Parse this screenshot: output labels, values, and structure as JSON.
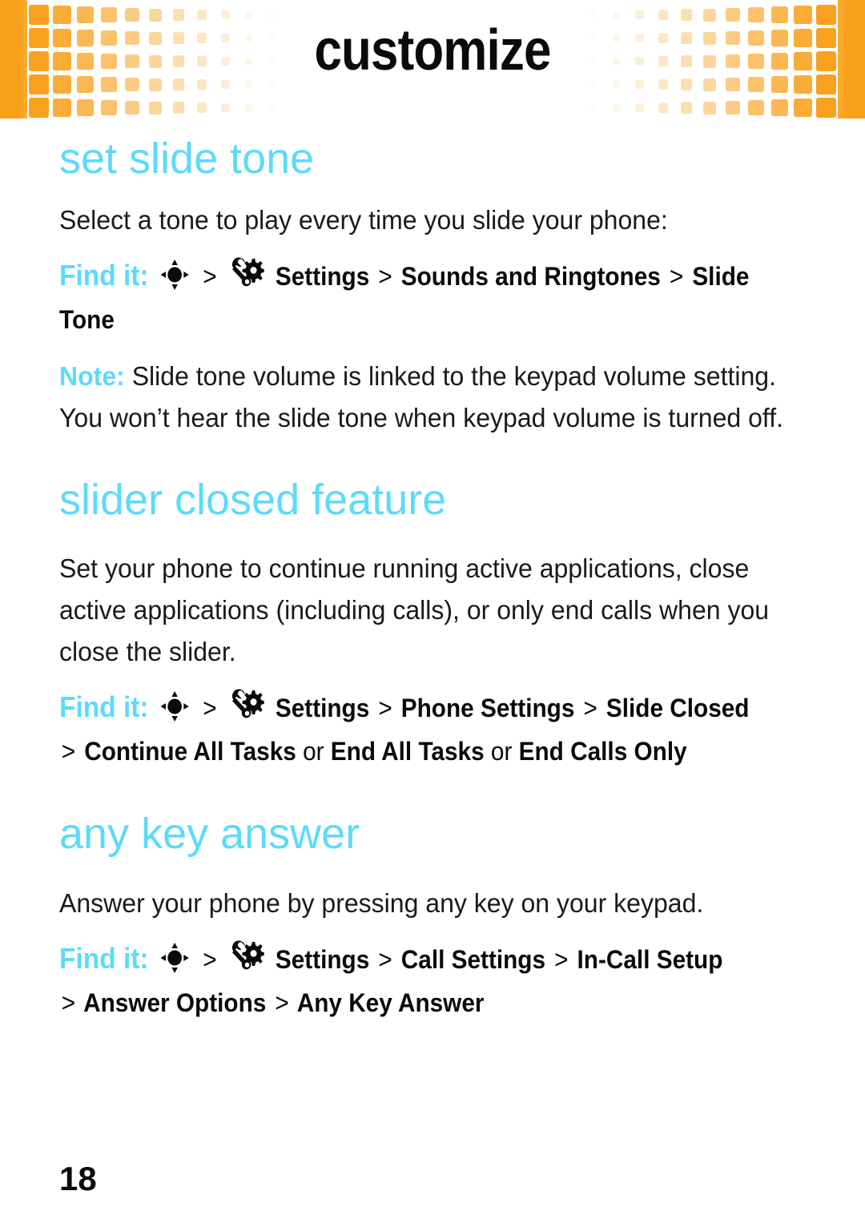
{
  "header": {
    "title": "customize",
    "accent_color": "#F9A01B"
  },
  "theme": {
    "heading_color": "#5BDBFA",
    "body_color": "#1a1a1a",
    "orange": "#F9A01B"
  },
  "icons": {
    "nav_key": "center-select-navigation-key-icon",
    "settings": "wrench-gear-settings-icon"
  },
  "sections": [
    {
      "heading": "set slide tone",
      "body": "Select a tone to play every time you slide your phone:",
      "findit": {
        "label": "Find it:",
        "crumbs": [
          "Settings",
          "Sounds and Ringtones",
          "Slide Tone"
        ],
        "separator": ">"
      },
      "note": {
        "label": "Note:",
        "text": "Slide tone volume is linked to the keypad volume setting. You won’t hear the slide tone when keypad volume is turned off."
      }
    },
    {
      "heading": "slider closed feature",
      "body": "Set your phone to continue running active applications, close active applications (including calls), or only end calls when you close the slider.",
      "findit": {
        "label": "Find it:",
        "crumbs": [
          "Settings",
          "Phone Settings",
          "Slide Closed"
        ],
        "separator": ">",
        "options_prefix": ">",
        "options": [
          "Continue All Tasks",
          "End All Tasks",
          "End Calls Only"
        ],
        "options_conjunction": "or"
      }
    },
    {
      "heading": "any key answer",
      "body": "Answer your phone by pressing any key on your keypad.",
      "findit": {
        "label": "Find it:",
        "crumbs": [
          "Settings",
          "Call Settings",
          "In-Call Setup"
        ],
        "separator": ">",
        "options_prefix": ">",
        "options": [
          "Answer Options",
          "Any Key Answer"
        ]
      }
    }
  ],
  "footer": {
    "page_number": "18"
  }
}
